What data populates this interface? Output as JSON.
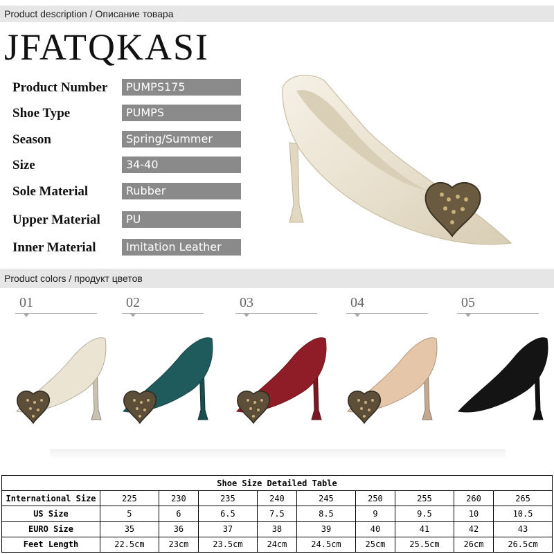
{
  "sections": {
    "description": "Product description / Описание товара",
    "colors": "Product colors / продукт цветов"
  },
  "brand": "JFATQKASI",
  "specs": [
    {
      "label": "Product Number",
      "value": "PUMPS175"
    },
    {
      "label": "Shoe Type",
      "value": "PUMPS"
    },
    {
      "label": "Season",
      "value": "Spring/Summer"
    },
    {
      "label": "Size",
      "value": "34-40"
    },
    {
      "label": "Sole Material",
      "value": "Rubber"
    },
    {
      "label": "Upper Material",
      "value": "PU"
    },
    {
      "label": "Inner Material",
      "value": "Imitation Leather"
    }
  ],
  "colors": [
    {
      "number": "01",
      "color": "#ece4d3"
    },
    {
      "number": "02",
      "color": "#1f5a5c"
    },
    {
      "number": "03",
      "color": "#8e1d27"
    },
    {
      "number": "04",
      "color": "#e6c6a8"
    },
    {
      "number": "05",
      "color": "#141414"
    }
  ],
  "size_table": {
    "caption": "Shoe Size Detailed Table",
    "rows": [
      {
        "label": "International Size",
        "values": [
          "225",
          "230",
          "235",
          "240",
          "245",
          "250",
          "255",
          "260",
          "265"
        ]
      },
      {
        "label": "US Size",
        "values": [
          "5",
          "6",
          "6.5",
          "7.5",
          "8.5",
          "9",
          "9.5",
          "10",
          "10.5"
        ]
      },
      {
        "label": "EURO Size",
        "values": [
          "35",
          "36",
          "37",
          "38",
          "39",
          "40",
          "41",
          "42",
          "43"
        ]
      },
      {
        "label": "Feet Length",
        "values": [
          "22.5cm",
          "23cm",
          "23.5cm",
          "24cm",
          "24.5cm",
          "25cm",
          "25.5cm",
          "26cm",
          "26.5cm"
        ]
      }
    ]
  }
}
